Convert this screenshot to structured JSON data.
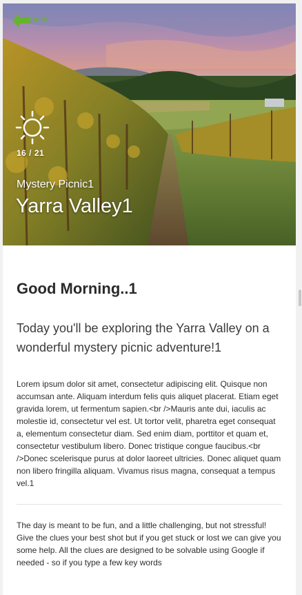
{
  "header": {
    "back_label": "BACK",
    "weather_icon": "sun-icon",
    "day_counter": "16 / 21",
    "subtitle": "Mystery Picnic1",
    "title": "Yarra Valley1"
  },
  "main": {
    "greeting": "Good Morning..1",
    "lead": "Today you'll be exploring the Yarra Valley on a wonderful mystery picnic adventure!1",
    "paragraph1": "Lorem ipsum dolor sit amet, consectetur adipiscing elit. Quisque non accumsan ante. Aliquam interdum felis quis aliquet placerat. Etiam eget gravida lorem, ut fermentum sapien.<br />Mauris ante dui, iaculis ac molestie id, consectetur vel est. Ut tortor velit, pharetra eget consequat a, elementum consectetur diam. Sed enim diam, porttitor et quam et, consectetur vestibulum libero. Donec tristique congue faucibus.<br />Donec scelerisque purus at dolor laoreet ultricies. Donec aliquet quam non libero fringilla aliquam. Vivamus risus magna, consequat a tempus vel.1",
    "paragraph2": "The day is meant to be fun, and a little challenging, but not stressful! Give the clues your best shot but if you get stuck or lost we can give you some help. All the clues are designed to be solvable using Google if needed - so if you type a few key words"
  },
  "colors": {
    "accent_green": "#66b32e",
    "text_dark": "#2a2a2a",
    "background": "#f1f1f1"
  }
}
